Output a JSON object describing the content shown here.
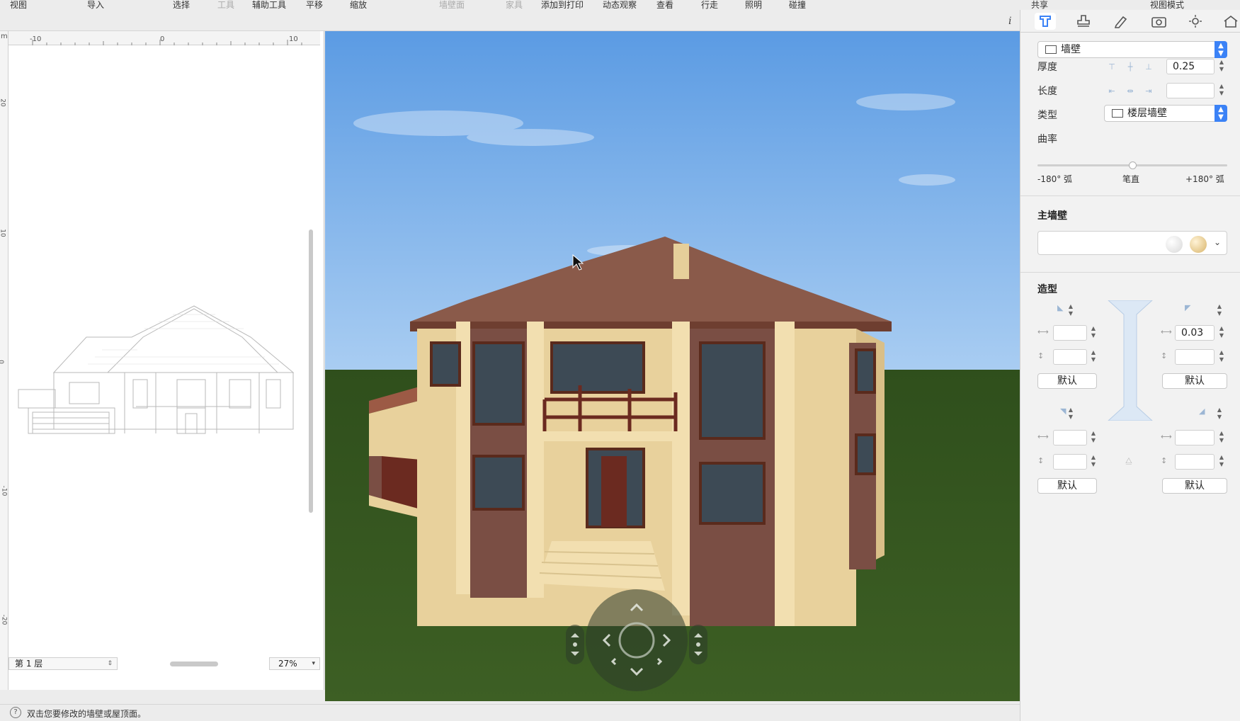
{
  "toolbar": {
    "items": [
      {
        "label": "视图",
        "dim": false
      },
      {
        "label": "导入",
        "dim": false
      },
      {
        "label": "选择",
        "dim": false
      },
      {
        "label": "工具",
        "dim": true
      },
      {
        "label": "辅助工具",
        "dim": false
      },
      {
        "label": "平移",
        "dim": false
      },
      {
        "label": "缩放",
        "dim": false
      },
      {
        "label": "墙壁面",
        "dim": true
      },
      {
        "label": "家具",
        "dim": true
      },
      {
        "label": "添加到打印",
        "dim": false
      },
      {
        "label": "动态观察",
        "dim": false
      },
      {
        "label": "查看",
        "dim": false
      },
      {
        "label": "行走",
        "dim": false
      },
      {
        "label": "照明",
        "dim": false
      },
      {
        "label": "碰撞",
        "dim": false
      }
    ],
    "share_label": "共享",
    "view_mode_label": "视图模式",
    "info_glyph": "i"
  },
  "plan": {
    "ruler_h": [
      "m",
      "-10",
      "0",
      "10"
    ],
    "ruler_v": [
      "20",
      "10",
      "0",
      "-10",
      "-20"
    ],
    "floor_selector": "第 1 层",
    "zoom": "27%"
  },
  "status": {
    "icon": "?",
    "text": "双击您要修改的墙壁或屋顶面。"
  },
  "panel": {
    "tabs": [
      "wall-tool-icon",
      "stamp-icon",
      "pencil-icon",
      "camera-icon",
      "sun-icon",
      "house-icon"
    ],
    "object_select": "墙壁",
    "thickness_label": "厚度",
    "thickness_value": "0.25",
    "length_label": "长度",
    "length_value": "",
    "type_label": "类型",
    "type_value": "楼层墙壁",
    "curvature_label": "曲率",
    "curvature_fraction": 0.5,
    "curve_left": "-180° 弧",
    "curve_mid": "笔直",
    "curve_right": "+180° 弧",
    "main_wall_label": "主墙壁",
    "profile_label": "造型",
    "profile_top_right_width": "0.03",
    "default_label": "默认"
  },
  "colors": {
    "accent": "#3b82f6",
    "sky_top": "#5b9be3",
    "grass": "#3a5a22",
    "roof": "#8a5a4a",
    "wall": "#e8d19c",
    "brick": "#7a4e44"
  }
}
